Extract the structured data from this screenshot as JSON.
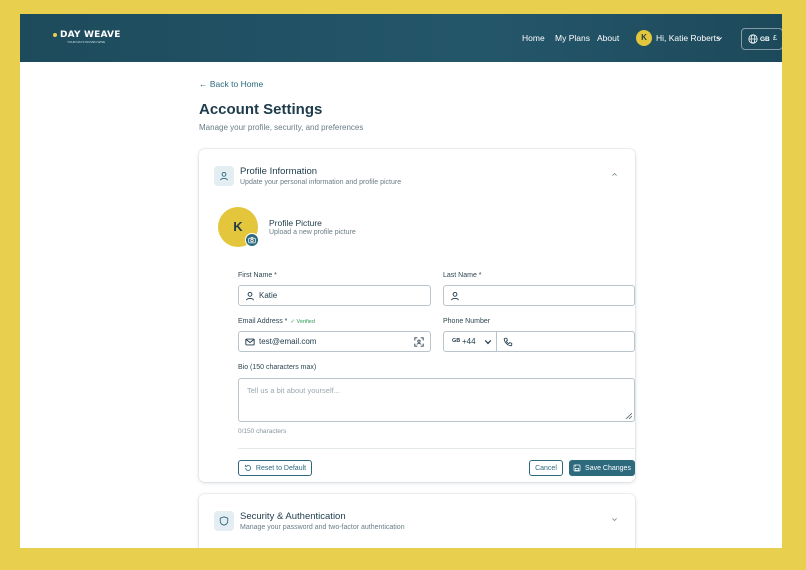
{
  "app": {
    "logo": "DAY WEAVE",
    "tagline": "YOUR DAYS WOVEN WISE"
  },
  "nav": {
    "links": [
      "Home",
      "My Plans",
      "About"
    ],
    "user_initial": "K",
    "user_greeting": "Hi, Katie Roberts",
    "lang_code": "GB",
    "currency": "£"
  },
  "page": {
    "back_link": "← Back to Home",
    "title": "Account Settings",
    "subtitle": "Manage your profile, security, and preferences"
  },
  "profile_section": {
    "title": "Profile Information",
    "subtitle": "Update your personal information and profile picture",
    "avatar_initial": "K",
    "picture_title": "Profile Picture",
    "picture_subtitle": "Upload a new profile picture",
    "first_name_label": "First Name *",
    "first_name_value": "Katie",
    "last_name_label": "Last Name *",
    "last_name_value": "",
    "email_label": "Email Address *",
    "email_verified": "✓ Verified",
    "email_value": "test@email.com",
    "phone_label": "Phone Number",
    "phone_flag": "GB",
    "phone_code": "+44",
    "phone_value": "",
    "bio_label": "Bio (150 characters max)",
    "bio_placeholder": "Tell us a bit about yourself...",
    "char_count": "0/150 characters",
    "reset_label": "Reset to Default",
    "cancel_label": "Cancel",
    "save_label": "Save Changes"
  },
  "security_section": {
    "title": "Security & Authentication",
    "subtitle": "Manage your password and two-factor authentication"
  },
  "colors": {
    "accent": "#2d6a7e",
    "header": "#1d4b5c",
    "avatar": "#e3c63b",
    "verified": "#2e9a55",
    "background": "#e8cf4e"
  },
  "icons": {
    "globe": "globe-icon",
    "user": "user-icon",
    "mail": "mail-icon",
    "scan": "scan-icon",
    "phone": "phone-icon",
    "camera": "camera-icon",
    "shield": "shield-icon",
    "reset": "reset-icon",
    "save": "save-icon"
  }
}
